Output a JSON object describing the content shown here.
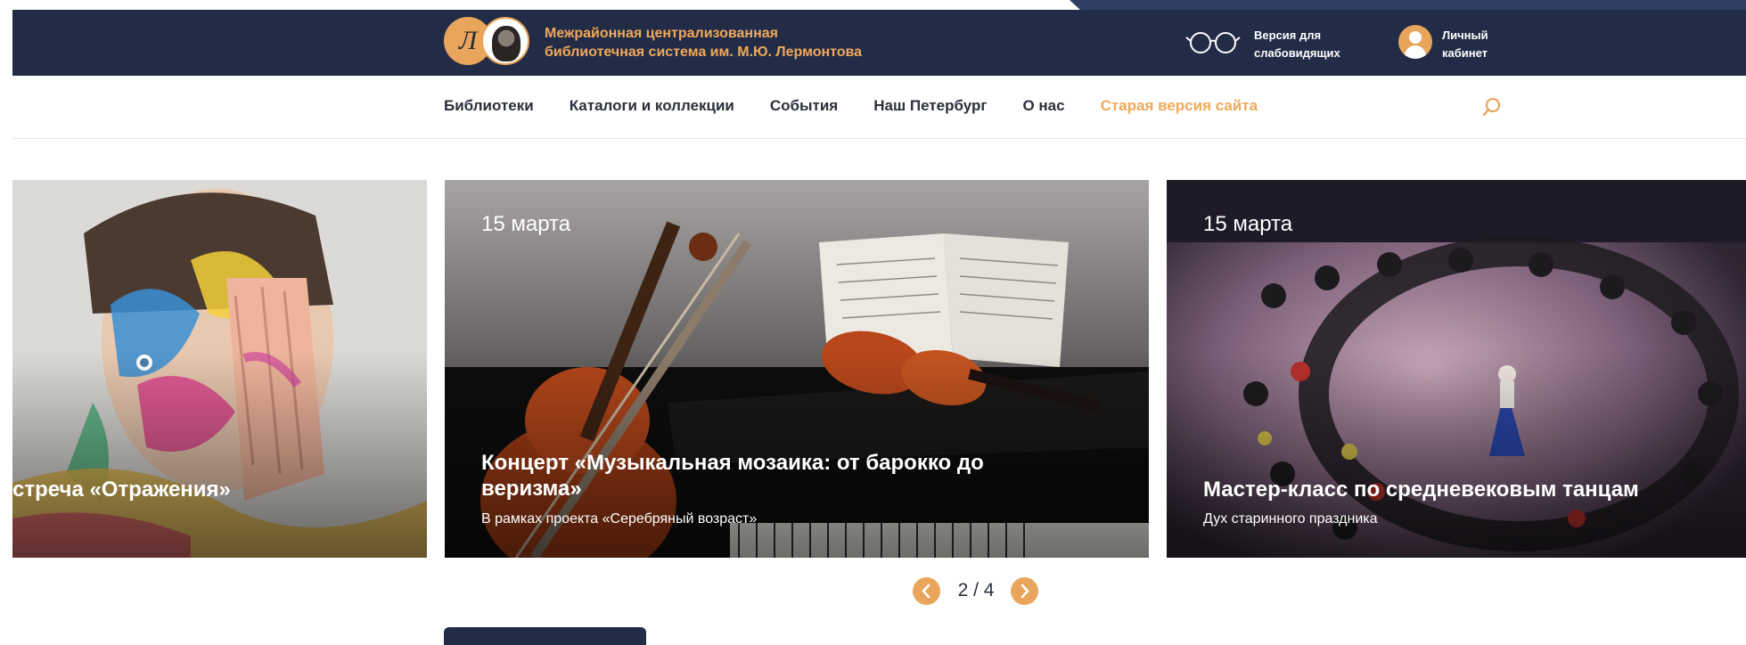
{
  "header": {
    "logo_letter": "Л",
    "org_name_line1": "Межрайонная централизованная",
    "org_name_line2": "библиотечная система им. М.Ю. Лермонтова",
    "vision_line1": "Версия для",
    "vision_line2": "слабовидящих",
    "account_line1": "Личный",
    "account_line2": "кабинет",
    "icons": {
      "vision": "glasses-icon",
      "account": "user-icon"
    }
  },
  "nav": {
    "items": [
      {
        "label": "Библиотеки"
      },
      {
        "label": "Каталоги и коллекции"
      },
      {
        "label": "События"
      },
      {
        "label": "Наш Петербург"
      },
      {
        "label": "О нас"
      },
      {
        "label": "Старая версия сайта"
      }
    ],
    "search_icon": "search-icon"
  },
  "slides": [
    {
      "title": "стреча «Отражения»"
    },
    {
      "date": "15 марта",
      "title_line1": "Концерт «Музыкальная мозаика: от барокко до",
      "title_line2": "веризма»",
      "subtitle": "В рамках проекта «Серебряный возраст»"
    },
    {
      "date": "15 марта",
      "title": "Мастер-класс по средневековым танцам",
      "subtitle": "Дух старинного праздника"
    }
  ],
  "pager": {
    "current": "2 / 4"
  },
  "colors": {
    "header_bg": "#222c47",
    "accent": "#e9a55c",
    "accent_text": "#f0a95a",
    "text": "#2b2f3a"
  }
}
